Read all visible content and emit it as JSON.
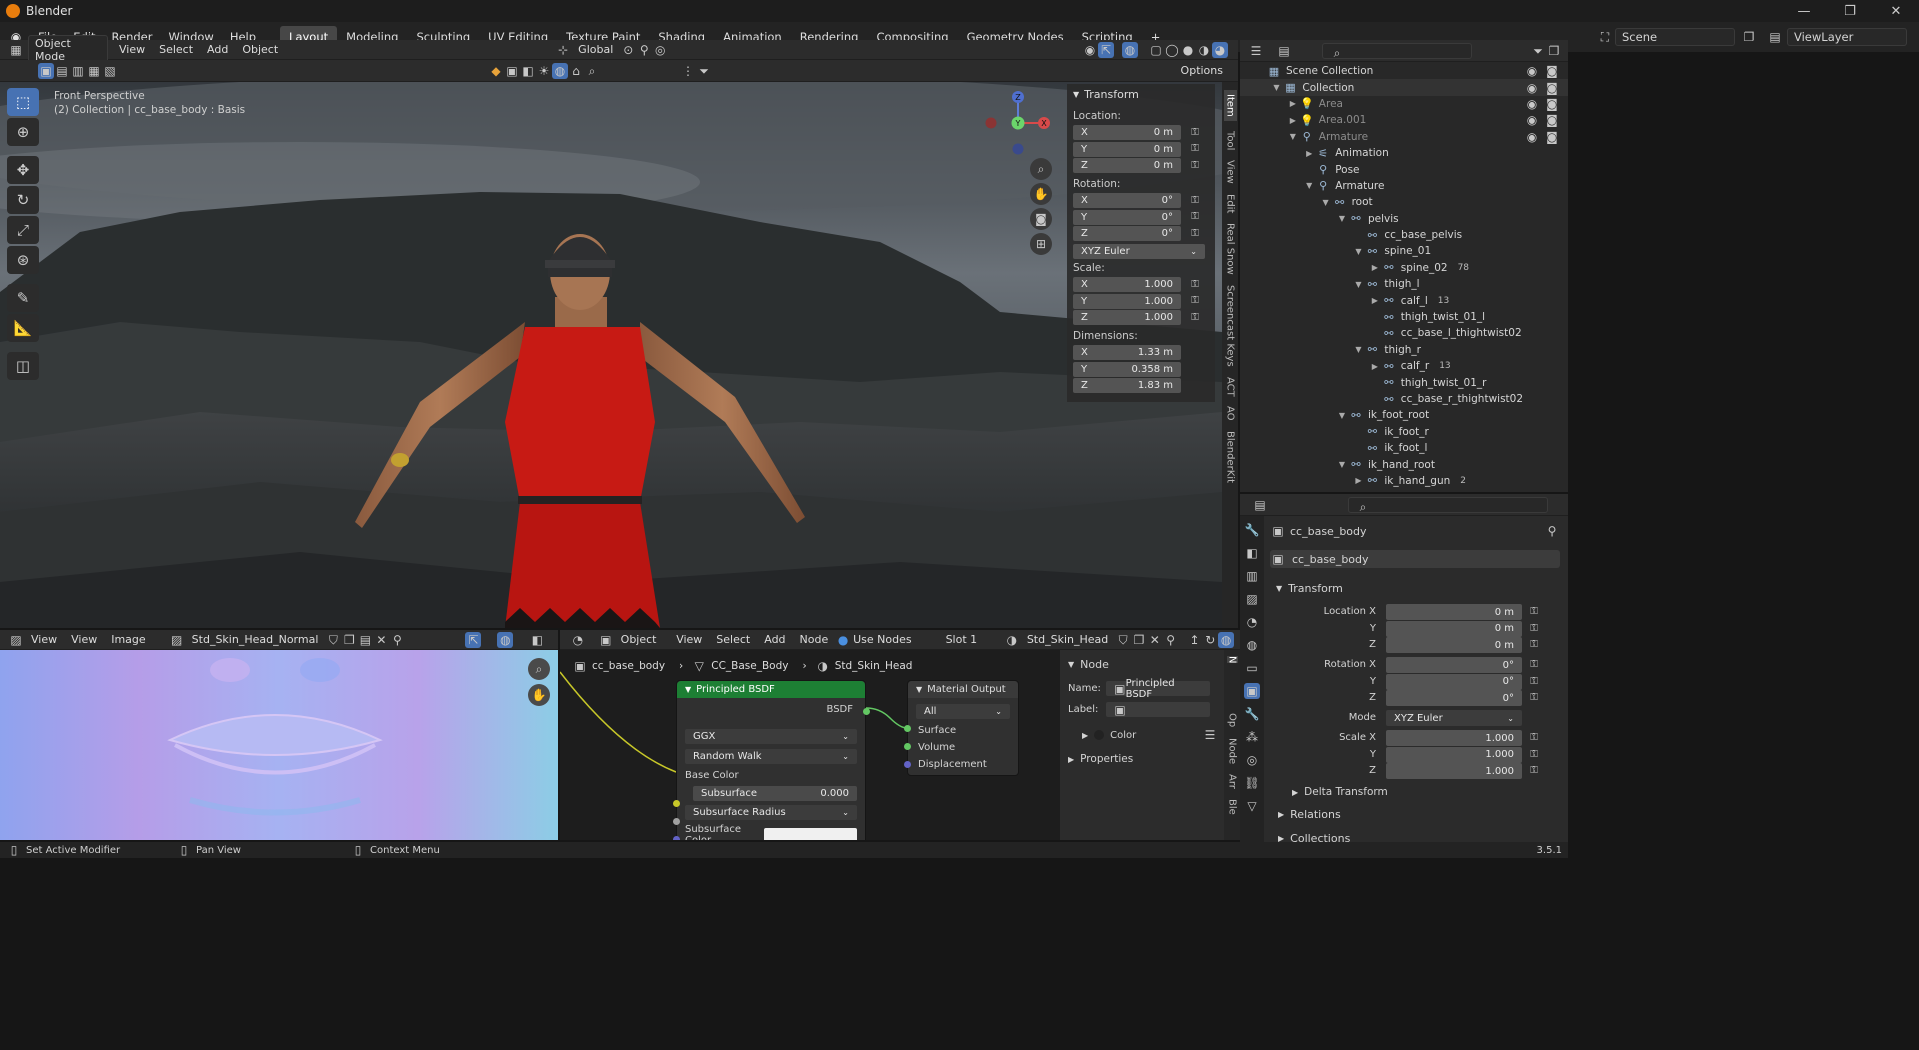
{
  "titlebar": {
    "title": "Blender",
    "min": "—",
    "max": "❐",
    "close": "✕"
  },
  "menu": [
    "File",
    "Edit",
    "Render",
    "Window",
    "Help"
  ],
  "workspaces": [
    {
      "label": "Layout",
      "active": true
    },
    {
      "label": "Modeling"
    },
    {
      "label": "Sculpting"
    },
    {
      "label": "UV Editing"
    },
    {
      "label": "Texture Paint"
    },
    {
      "label": "Shading"
    },
    {
      "label": "Animation"
    },
    {
      "label": "Rendering"
    },
    {
      "label": "Compositing"
    },
    {
      "label": "Geometry Nodes"
    },
    {
      "label": "Scripting"
    }
  ],
  "workspace_add": "+",
  "topright": {
    "scene": "Scene",
    "viewlayer": "ViewLayer"
  },
  "viewport_header": {
    "mode": "Object Mode",
    "menus": [
      "View",
      "Select",
      "Add",
      "Object"
    ],
    "orientation": "Global",
    "options": "Options"
  },
  "viewport": {
    "perspective": "Front Perspective",
    "collection": "(2) Collection | cc_base_body : Basis",
    "gizmo": {
      "x": "X",
      "y": "Y",
      "z": "Z"
    }
  },
  "transform_panel": {
    "title": "Transform",
    "location_label": "Location:",
    "location": [
      {
        "axis": "X",
        "value": "0 m"
      },
      {
        "axis": "Y",
        "value": "0 m"
      },
      {
        "axis": "Z",
        "value": "0 m"
      }
    ],
    "rotation_label": "Rotation:",
    "rotation": [
      {
        "axis": "X",
        "value": "0°"
      },
      {
        "axis": "Y",
        "value": "0°"
      },
      {
        "axis": "Z",
        "value": "0°"
      }
    ],
    "rotation_mode": "XYZ Euler",
    "scale_label": "Scale:",
    "scale": [
      {
        "axis": "X",
        "value": "1.000"
      },
      {
        "axis": "Y",
        "value": "1.000"
      },
      {
        "axis": "Z",
        "value": "1.000"
      }
    ],
    "dimensions_label": "Dimensions:",
    "dimensions": [
      {
        "axis": "X",
        "value": "1.33 m"
      },
      {
        "axis": "Y",
        "value": "0.358 m"
      },
      {
        "axis": "Z",
        "value": "1.83 m"
      }
    ]
  },
  "sidebar_tabs": [
    "Item",
    "Tool",
    "View",
    "Edit",
    "Real Snow",
    "Screencast Keys",
    "ACT",
    "AO",
    "BlenderKit"
  ],
  "outliner": {
    "rows": [
      {
        "label": "Scene Collection",
        "depth": 0,
        "icon": "▦",
        "tri": ""
      },
      {
        "label": "Collection",
        "depth": 1,
        "icon": "▦",
        "tri": "▼"
      },
      {
        "label": "Area",
        "depth": 2,
        "icon": "💡",
        "tri": "▶",
        "dim": true
      },
      {
        "label": "Area.001",
        "depth": 2,
        "icon": "💡",
        "tri": "▶",
        "dim": true
      },
      {
        "label": "Armature",
        "depth": 2,
        "icon": "⚲",
        "tri": "▼",
        "dim": true
      },
      {
        "label": "Animation",
        "depth": 3,
        "icon": "⚟",
        "tri": "▶"
      },
      {
        "label": "Pose",
        "depth": 3,
        "icon": "⚲",
        "tri": ""
      },
      {
        "label": "Armature",
        "depth": 3,
        "icon": "⚲",
        "tri": "▼"
      },
      {
        "label": "root",
        "depth": 4,
        "icon": "⚯",
        "tri": "▼"
      },
      {
        "label": "pelvis",
        "depth": 5,
        "icon": "⚯",
        "tri": "▼"
      },
      {
        "label": "cc_base_pelvis",
        "depth": 6,
        "icon": "⚯",
        "tri": ""
      },
      {
        "label": "spine_01",
        "depth": 6,
        "icon": "⚯",
        "tri": "▼"
      },
      {
        "label": "spine_02",
        "depth": 7,
        "icon": "⚯",
        "tri": "▶",
        "badge": "78"
      },
      {
        "label": "thigh_l",
        "depth": 6,
        "icon": "⚯",
        "tri": "▼"
      },
      {
        "label": "calf_l",
        "depth": 7,
        "icon": "⚯",
        "tri": "▶",
        "badge": "13"
      },
      {
        "label": "thigh_twist_01_l",
        "depth": 7,
        "icon": "⚯",
        "tri": ""
      },
      {
        "label": "cc_base_l_thightwist02",
        "depth": 7,
        "icon": "⚯",
        "tri": ""
      },
      {
        "label": "thigh_r",
        "depth": 6,
        "icon": "⚯",
        "tri": "▼"
      },
      {
        "label": "calf_r",
        "depth": 7,
        "icon": "⚯",
        "tri": "▶",
        "badge": "13"
      },
      {
        "label": "thigh_twist_01_r",
        "depth": 7,
        "icon": "⚯",
        "tri": ""
      },
      {
        "label": "cc_base_r_thightwist02",
        "depth": 7,
        "icon": "⚯",
        "tri": ""
      },
      {
        "label": "ik_foot_root",
        "depth": 5,
        "icon": "⚯",
        "tri": "▼"
      },
      {
        "label": "ik_foot_r",
        "depth": 6,
        "icon": "⚯",
        "tri": ""
      },
      {
        "label": "ik_foot_l",
        "depth": 6,
        "icon": "⚯",
        "tri": ""
      },
      {
        "label": "ik_hand_root",
        "depth": 5,
        "icon": "⚯",
        "tri": "▼"
      },
      {
        "label": "ik_hand_gun",
        "depth": 6,
        "icon": "⚯",
        "tri": "▶",
        "badge": "2"
      }
    ]
  },
  "properties": {
    "object_name": "cc_base_body",
    "data_name": "cc_base_body",
    "transform_title": "Transform",
    "location_x_label": "Location X",
    "rotation_x_label": "Rotation X",
    "scale_x_label": "Scale X",
    "y_label": "Y",
    "z_label": "Z",
    "location": [
      "0 m",
      "0 m",
      "0 m"
    ],
    "rotation": [
      "0°",
      "0°",
      "0°"
    ],
    "mode_label": "Mode",
    "mode_value": "XYZ Euler",
    "scale": [
      "1.000",
      "1.000",
      "1.000"
    ],
    "delta_transform": "Delta Transform",
    "relations": "Relations",
    "collections": "Collections"
  },
  "image_editor": {
    "menus": [
      "View",
      "View",
      "Image"
    ],
    "image_name": "Std_Skin_Head_Normal"
  },
  "node_editor": {
    "type": "Object",
    "menus": [
      "View",
      "Select",
      "Add",
      "Node"
    ],
    "use_nodes": "Use Nodes",
    "slot": "Slot 1",
    "material": "Std_Skin_Head",
    "breadcrumb": [
      "cc_base_body",
      "CC_Base_Body",
      "Std_Skin_Head"
    ],
    "bsdf_node": {
      "title": "Principled BSDF",
      "output": "BSDF",
      "distribution": "GGX",
      "subsurface_method": "Random Walk",
      "base_color": "Base Color",
      "subsurface_label": "Subsurface",
      "subsurface_value": "0.000",
      "subsurface_radius": "Subsurface Radius",
      "subsurface_color": "Subsurface Color"
    },
    "output_node": {
      "title": "Material Output",
      "target": "All",
      "inputs": [
        "Surface",
        "Volume",
        "Displacement"
      ]
    },
    "side": {
      "node_title": "Node",
      "name_label": "Name:",
      "name_value": "Principled BSDF",
      "label_label": "Label:",
      "color": "Color",
      "properties": "Properties"
    },
    "side_tabs": [
      "N",
      "Op",
      "Node",
      "Arr",
      "Ble"
    ]
  },
  "statusbar": {
    "left": "Set Active Modifier",
    "mid": "Pan View",
    "right": "Context Menu",
    "version": "3.5.1"
  },
  "colors": {
    "accent": "#4772b3",
    "node_green": "#1d7f34",
    "socket_yellow": "#c7c729",
    "socket_green": "#63c763",
    "socket_purple": "#6363c7",
    "tunic_red": "#c71a14"
  }
}
